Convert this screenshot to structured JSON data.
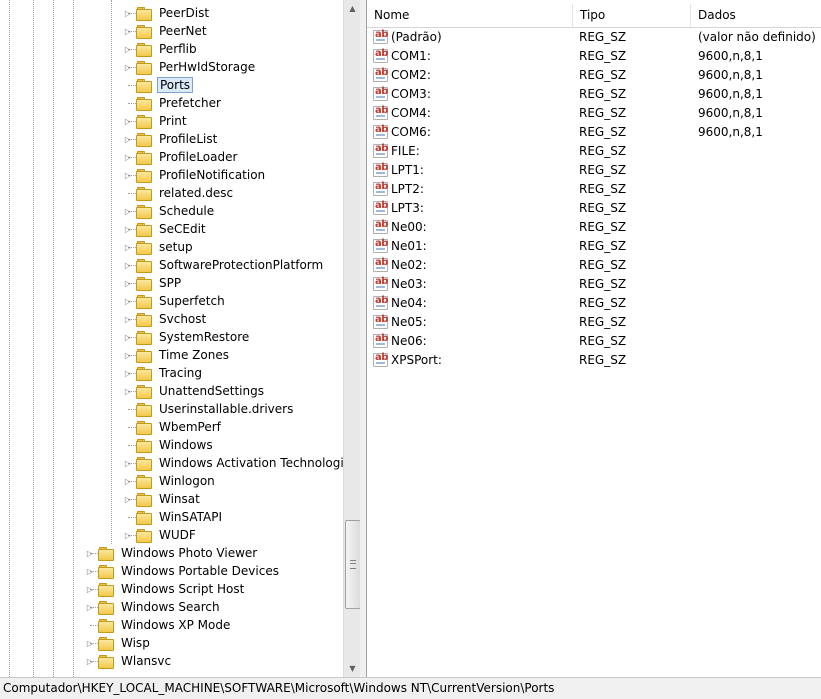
{
  "tree": {
    "items": [
      {
        "label": "PeerDist",
        "expandable": true
      },
      {
        "label": "PeerNet",
        "expandable": true
      },
      {
        "label": "Perflib",
        "expandable": true
      },
      {
        "label": "PerHwIdStorage",
        "expandable": true
      },
      {
        "label": "Ports",
        "expandable": false,
        "selected": true
      },
      {
        "label": "Prefetcher",
        "expandable": false
      },
      {
        "label": "Print",
        "expandable": true
      },
      {
        "label": "ProfileList",
        "expandable": true
      },
      {
        "label": "ProfileLoader",
        "expandable": true
      },
      {
        "label": "ProfileNotification",
        "expandable": true
      },
      {
        "label": "related.desc",
        "expandable": false
      },
      {
        "label": "Schedule",
        "expandable": true
      },
      {
        "label": "SeCEdit",
        "expandable": true
      },
      {
        "label": "setup",
        "expandable": true
      },
      {
        "label": "SoftwareProtectionPlatform",
        "expandable": true
      },
      {
        "label": "SPP",
        "expandable": true
      },
      {
        "label": "Superfetch",
        "expandable": true
      },
      {
        "label": "Svchost",
        "expandable": true
      },
      {
        "label": "SystemRestore",
        "expandable": true
      },
      {
        "label": "Time Zones",
        "expandable": true
      },
      {
        "label": "Tracing",
        "expandable": true
      },
      {
        "label": "UnattendSettings",
        "expandable": true
      },
      {
        "label": "Userinstallable.drivers",
        "expandable": false
      },
      {
        "label": "WbemPerf",
        "expandable": false
      },
      {
        "label": "Windows",
        "expandable": false
      },
      {
        "label": "Windows Activation Technologies",
        "expandable": true
      },
      {
        "label": "Winlogon",
        "expandable": true
      },
      {
        "label": "Winsat",
        "expandable": true
      },
      {
        "label": "WinSATAPI",
        "expandable": false
      },
      {
        "label": "WUDF",
        "expandable": true
      }
    ],
    "parent_items": [
      {
        "label": "Windows Photo Viewer",
        "expandable": true
      },
      {
        "label": "Windows Portable Devices",
        "expandable": true
      },
      {
        "label": "Windows Script Host",
        "expandable": true
      },
      {
        "label": "Windows Search",
        "expandable": true
      },
      {
        "label": "Windows XP Mode",
        "expandable": false
      },
      {
        "label": "Wisp",
        "expandable": true
      },
      {
        "label": "Wlansvc",
        "expandable": true
      }
    ]
  },
  "list": {
    "columns": [
      "Nome",
      "Tipo",
      "Dados"
    ],
    "icon_text": "ab",
    "rows": [
      {
        "name": "(Padrão)",
        "type": "REG_SZ",
        "data": "(valor não definido)"
      },
      {
        "name": "COM1:",
        "type": "REG_SZ",
        "data": "9600,n,8,1"
      },
      {
        "name": "COM2:",
        "type": "REG_SZ",
        "data": "9600,n,8,1"
      },
      {
        "name": "COM3:",
        "type": "REG_SZ",
        "data": "9600,n,8,1"
      },
      {
        "name": "COM4:",
        "type": "REG_SZ",
        "data": "9600,n,8,1"
      },
      {
        "name": "COM6:",
        "type": "REG_SZ",
        "data": "9600,n,8,1"
      },
      {
        "name": "FILE:",
        "type": "REG_SZ",
        "data": ""
      },
      {
        "name": "LPT1:",
        "type": "REG_SZ",
        "data": ""
      },
      {
        "name": "LPT2:",
        "type": "REG_SZ",
        "data": ""
      },
      {
        "name": "LPT3:",
        "type": "REG_SZ",
        "data": ""
      },
      {
        "name": "Ne00:",
        "type": "REG_SZ",
        "data": ""
      },
      {
        "name": "Ne01:",
        "type": "REG_SZ",
        "data": ""
      },
      {
        "name": "Ne02:",
        "type": "REG_SZ",
        "data": ""
      },
      {
        "name": "Ne03:",
        "type": "REG_SZ",
        "data": ""
      },
      {
        "name": "Ne04:",
        "type": "REG_SZ",
        "data": ""
      },
      {
        "name": "Ne05:",
        "type": "REG_SZ",
        "data": ""
      },
      {
        "name": "Ne06:",
        "type": "REG_SZ",
        "data": ""
      },
      {
        "name": "XPSPort:",
        "type": "REG_SZ",
        "data": ""
      }
    ]
  },
  "status_bar": "Computador\\HKEY_LOCAL_MACHINE\\SOFTWARE\\Microsoft\\Windows NT\\CurrentVersion\\Ports",
  "colors": {
    "selection": "#d9ebf9",
    "selection_border": "#7da2ce",
    "icon_red": "#c0392b"
  }
}
